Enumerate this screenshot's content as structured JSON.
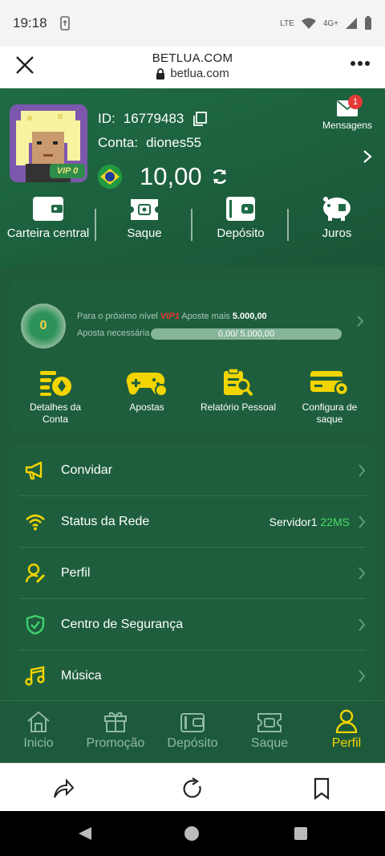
{
  "status_bar": {
    "time": "19:18",
    "network": "LTE",
    "signal_label": "4G+"
  },
  "browser": {
    "site_title": "BETLUA.COM",
    "url": "betlua.com"
  },
  "profile": {
    "vip_badge": "VIP 0",
    "id_label": "ID:",
    "id_value": "16779483",
    "account_label": "Conta:",
    "account_value": "diones55",
    "balance": "10,00",
    "messages_label": "Mensagens",
    "messages_count": "1"
  },
  "quick_actions": [
    {
      "label": "Carteira central",
      "icon": "wallet-icon"
    },
    {
      "label": "Saque",
      "icon": "ticket-icon"
    },
    {
      "label": "Depósito",
      "icon": "card-wallet-icon"
    },
    {
      "label": "Juros",
      "icon": "piggy-bank-icon"
    }
  ],
  "vip": {
    "medal_level": "0",
    "next_level_text": "Para o próximo nível",
    "next_vip": "VIP1",
    "bet_more_text": "Aposte mais",
    "bet_more_amount": "5.000,00",
    "needed_label": "Aposta necessária",
    "progress_text": "0,00/ 5.000,00",
    "progress_fraction": 0
  },
  "vip_tools": [
    {
      "label_line1": "Detalhes da",
      "label_line2": "Conta",
      "icon": "account-details-icon"
    },
    {
      "label_line1": "Apostas",
      "label_line2": "",
      "icon": "gamepad-icon"
    },
    {
      "label_line1": "Relatório Pessoal",
      "label_line2": "",
      "icon": "report-icon"
    },
    {
      "label_line1": "Configura de",
      "label_line2": "saque",
      "icon": "card-settings-icon"
    }
  ],
  "menu": [
    {
      "label": "Convidar",
      "icon": "megaphone-icon"
    },
    {
      "label": "Status da Rede",
      "icon": "wifi-icon",
      "server": "Servidor1",
      "latency": "22MS"
    },
    {
      "label": "Perfil",
      "icon": "user-edit-icon"
    },
    {
      "label": "Centro de Segurança",
      "icon": "shield-icon"
    },
    {
      "label": "Música",
      "icon": "music-icon"
    }
  ],
  "bottom_nav": [
    {
      "label": "Inicio",
      "icon": "home-icon"
    },
    {
      "label": "Promoção",
      "icon": "gift-icon"
    },
    {
      "label": "Depósito",
      "icon": "wallet-icon"
    },
    {
      "label": "Saque",
      "icon": "ticket-icon"
    },
    {
      "label": "Perfil",
      "icon": "user-icon",
      "active": true
    }
  ],
  "colors": {
    "accent": "#f2d400",
    "bg": "#1f5a3a",
    "latency": "#4ade6a",
    "vip": "#e53935"
  }
}
